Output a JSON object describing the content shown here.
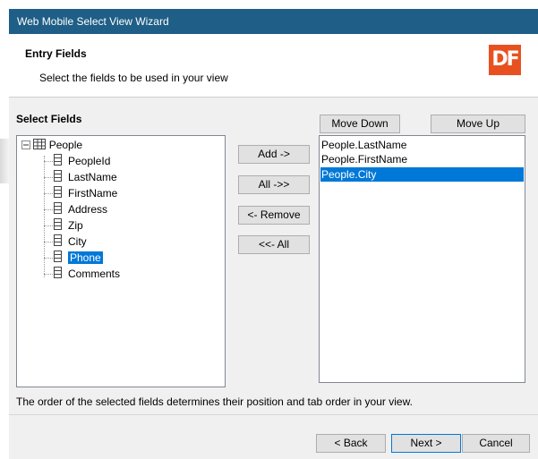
{
  "window": {
    "title": "Web Mobile Select View Wizard"
  },
  "header": {
    "title": "Entry Fields",
    "subtitle": "Select the fields to be used in your view",
    "logo_text": "DF",
    "logo_color": "#e8511f"
  },
  "select_fields": {
    "label": "Select Fields",
    "root": "People",
    "fields": [
      "PeopleId",
      "LastName",
      "FirstName",
      "Address",
      "Zip",
      "City",
      "Phone",
      "Comments"
    ],
    "selected_field": "Phone"
  },
  "actions": {
    "add": "Add ->",
    "all": "All ->>",
    "remove": "<- Remove",
    "remove_all": "<<- All",
    "move_down": "Move Down",
    "move_up": "Move Up"
  },
  "selected_list": {
    "items": [
      "People.LastName",
      "People.FirstName",
      "People.City"
    ],
    "selected_item": "People.City"
  },
  "note": "The order of the selected fields determines their position and tab order in your view.",
  "nav": {
    "back": "< Back",
    "next": "Next >",
    "cancel": "Cancel"
  },
  "colors": {
    "titlebar": "#1f5e86",
    "selection": "#0078d7"
  }
}
